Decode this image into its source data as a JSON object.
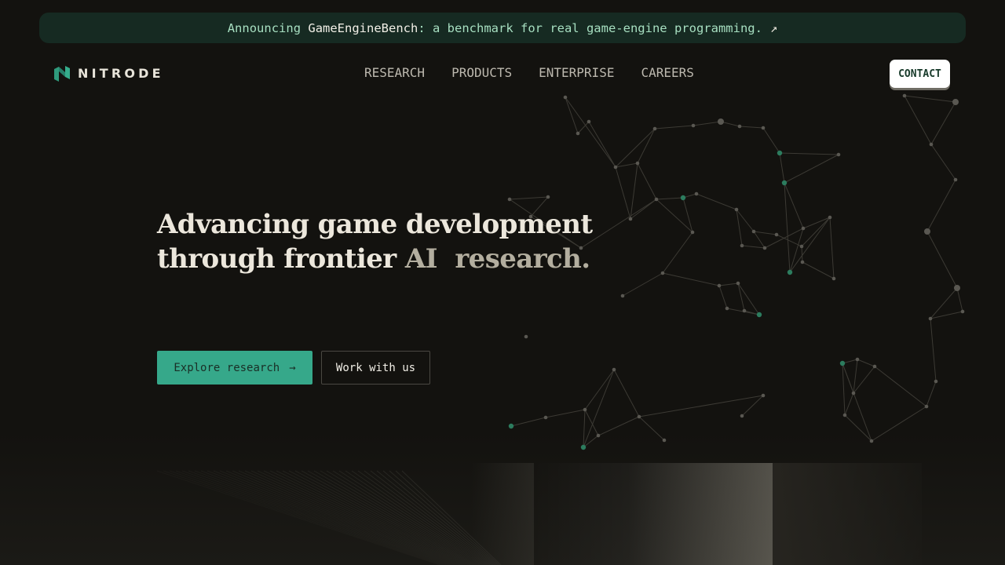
{
  "announcement": {
    "prefix": "Announcing ",
    "highlight": "GameEngineBench",
    "suffix": ": a benchmark for real game-engine programming.",
    "arrow": "↗"
  },
  "brand": {
    "name": "NITRODE",
    "logo_icon": "nitrode-logo-icon",
    "accent": "#2f9a7c"
  },
  "nav": {
    "items": [
      {
        "label": "RESEARCH"
      },
      {
        "label": "PRODUCTS"
      },
      {
        "label": "ENTERPRISE"
      },
      {
        "label": "CAREERS"
      }
    ]
  },
  "contact_label": "CONTACT",
  "hero": {
    "line1": "Advancing game development",
    "line2_a": "through frontier ",
    "line2_b": "AI  research."
  },
  "cta": {
    "primary_label": "Explore research",
    "primary_icon": "arrow-right-icon",
    "primary_arrow": "→",
    "secondary_label": "Work with us"
  },
  "colors": {
    "background": "#13120f",
    "announce_bg": "#162a22",
    "primary_button": "#36a88a",
    "node": "#5a5852",
    "node_accent": "#2c7c5e"
  }
}
